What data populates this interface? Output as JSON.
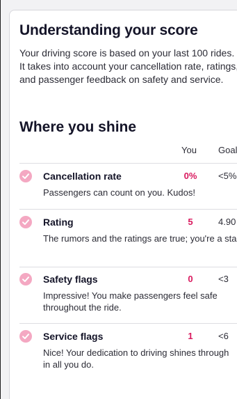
{
  "score_info": {
    "title": "Understanding your score",
    "description": "Your driving score is based on your last 100 rides. It takes into account your cancellation rate, ratings, and passenger feedback on safety and service."
  },
  "shine": {
    "title": "Where you shine",
    "col_you": "You",
    "col_goal": "Goal",
    "metrics": [
      {
        "label": "Cancellation rate",
        "you": "0%",
        "goal": "<5%",
        "note": "Passengers can count on you. Kudos!",
        "icon": "check-circle-icon"
      },
      {
        "label": "Rating",
        "you": "5",
        "goal": "4.90",
        "note": "The rumors and the ratings are true; you're a star!",
        "icon": "check-circle-icon"
      },
      {
        "label": "Safety flags",
        "you": "0",
        "goal": "<3",
        "note": "Impressive! You make passengers feel safe throughout the ride.",
        "icon": "check-circle-icon"
      },
      {
        "label": "Service flags",
        "you": "1",
        "goal": "<6",
        "note1": "Nice! Your dedication to driving shines through",
        "note2": "in all you do.",
        "icon": "check-circle-icon"
      }
    ]
  },
  "colors": {
    "accent": "#d9195e",
    "check_fill": "#f4a8c2",
    "heading": "#141428"
  }
}
